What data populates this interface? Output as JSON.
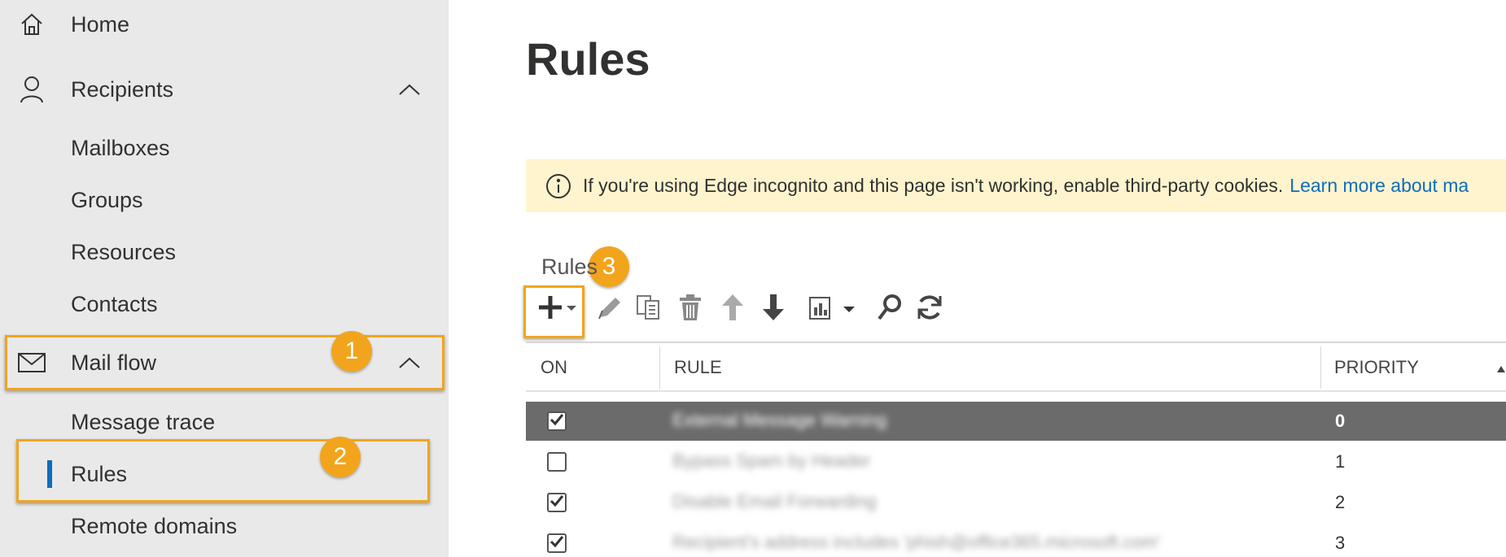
{
  "sidebar": {
    "home": "Home",
    "recipients": "Recipients",
    "mailboxes": "Mailboxes",
    "groups": "Groups",
    "resources": "Resources",
    "contacts": "Contacts",
    "mail_flow": "Mail flow",
    "message_trace": "Message trace",
    "rules": "Rules",
    "remote_domains": "Remote domains"
  },
  "callouts": {
    "one": "1",
    "two": "2",
    "three": "3"
  },
  "main": {
    "title": "Rules",
    "banner": {
      "message": "If you're using Edge incognito and this page isn't working, enable third-party cookies.",
      "link": "Learn more about ma"
    },
    "section_label": "Rules",
    "toolbar": {
      "icons": [
        "add-icon",
        "edit-icon",
        "copy-icon",
        "delete-icon",
        "move-up-icon",
        "move-down-icon",
        "report-icon",
        "search-icon",
        "refresh-icon"
      ]
    },
    "table": {
      "columns": {
        "on": "ON",
        "rule": "RULE",
        "priority": "PRIORITY"
      },
      "rows": [
        {
          "on": true,
          "rule": "External Message Warning",
          "priority": "0",
          "selected": true
        },
        {
          "on": false,
          "rule": "Bypass Spam by Header",
          "priority": "1",
          "selected": false
        },
        {
          "on": true,
          "rule": "Disable Email Forwarding",
          "priority": "2",
          "selected": false
        },
        {
          "on": true,
          "rule": "Recipient's address includes 'phish@office365.microsoft.com'",
          "priority": "3",
          "selected": false
        }
      ]
    }
  },
  "colors": {
    "accent": "#0f6cbd",
    "callout": "#f2a51c",
    "banner_bg": "#fff4ce",
    "selected_row": "#6b6b6b"
  }
}
